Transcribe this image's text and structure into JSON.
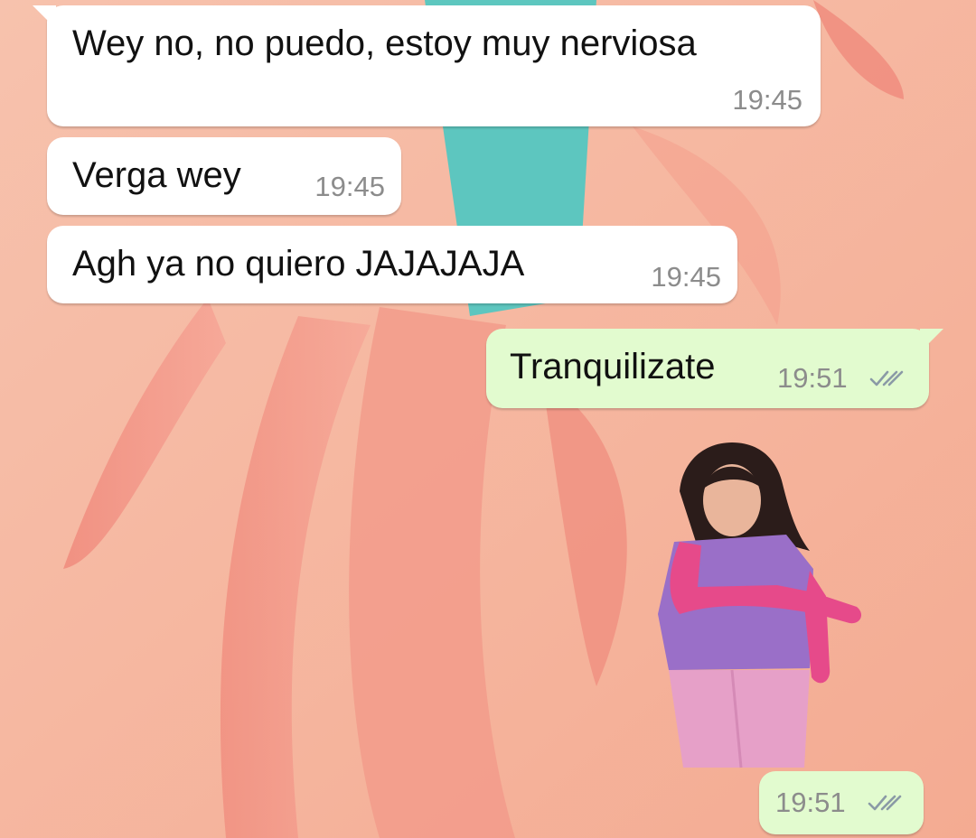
{
  "messages": [
    {
      "direction": "incoming",
      "text": "Wey no, no puedo, estoy muy nerviosa",
      "time": "19:45"
    },
    {
      "direction": "incoming",
      "text": "Verga wey",
      "time": "19:45"
    },
    {
      "direction": "incoming",
      "text": "Agh ya no quiero JAJAJAJA",
      "time": "19:45"
    },
    {
      "direction": "outgoing",
      "text": "Tranquilizate",
      "time": "19:51",
      "status": "read"
    },
    {
      "direction": "outgoing",
      "type": "sticker",
      "sticker_icon": "dancing-girl-sticker",
      "time": "19:51",
      "status": "read"
    }
  ],
  "colors": {
    "wallpaper": "#f6b7a0",
    "incoming_bubble": "#ffffff",
    "outgoing_bubble": "#e2fbcf",
    "timestamp": "#8c8c8c",
    "read_ticks": "#8a9aa6"
  }
}
